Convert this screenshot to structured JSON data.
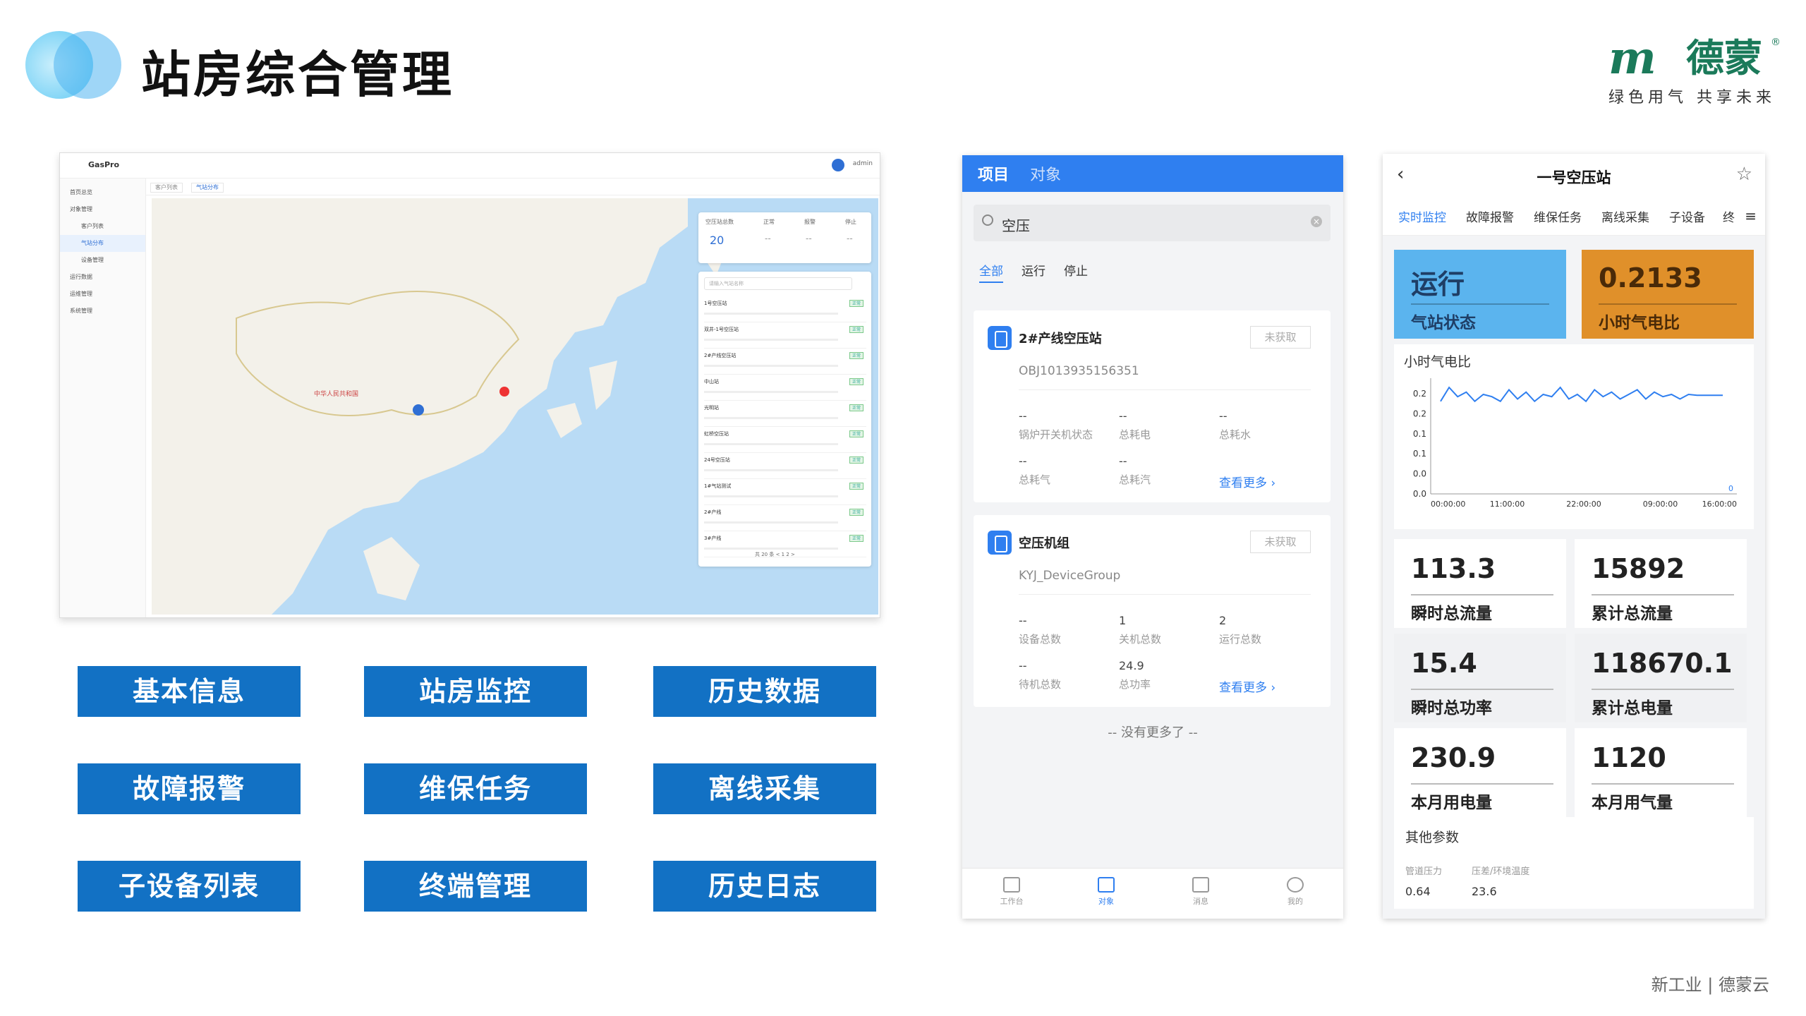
{
  "header": {
    "title": "站房综合管理"
  },
  "logo": {
    "mark": "m",
    "name": "德蒙",
    "registered": "®",
    "slogan": "绿色用气 共享未来"
  },
  "desktop": {
    "app_name": "GasPro",
    "user": "admin",
    "sidebar": [
      "首页总览",
      "对象管理",
      "客户列表",
      "气站分布",
      "设备管理",
      "运行数据",
      "运维管理",
      "系统管理"
    ],
    "tabs": [
      "客户列表",
      "气站分布"
    ],
    "map_label": "中华人民共和国",
    "stats": {
      "headers": [
        "空压站总数",
        "正常",
        "报警",
        "停止"
      ],
      "total": "20",
      "normal": "--",
      "alarm": "--",
      "stop": "--"
    },
    "search_placeholder": "请输入气站名称",
    "stations": [
      "1号空压站",
      "双井-1号空压站",
      "2#产线空压站",
      "中山站",
      "光明站",
      "虹桥空压站",
      "24号空压站",
      "1#气站测试",
      "2#产线",
      "3#产线"
    ],
    "badge": "正常",
    "pager": "共 20 条 < 1 2 >"
  },
  "buttons": [
    "基本信息",
    "站房监控",
    "历史数据",
    "故障报警",
    "维保任务",
    "离线采集",
    "子设备列表",
    "终端管理",
    "历史日志"
  ],
  "phone1": {
    "tabs": [
      "项目",
      "对象"
    ],
    "search": "空压",
    "filters": [
      "全部",
      "运行",
      "停止"
    ],
    "card1": {
      "name": "2#产线空压站",
      "status": "未获取",
      "code": "OBJ1013935156351",
      "fields": [
        {
          "value": "--",
          "label": "锅炉开关机状态"
        },
        {
          "value": "--",
          "label": "总耗电"
        },
        {
          "value": "--",
          "label": "总耗水"
        },
        {
          "value": "--",
          "label": "总耗气"
        },
        {
          "value": "--",
          "label": "总耗汽"
        }
      ],
      "more": "查看更多 ›"
    },
    "card2": {
      "name": "空压机组",
      "status": "未获取",
      "code": "KYJ_DeviceGroup",
      "fields": [
        {
          "value": "--",
          "label": "设备总数"
        },
        {
          "value": "1",
          "label": "关机总数"
        },
        {
          "value": "2",
          "label": "运行总数"
        },
        {
          "value": "--",
          "label": "待机总数"
        },
        {
          "value": "24.9",
          "label": "总功率"
        }
      ],
      "more": "查看更多 ›"
    },
    "end_text": "-- 没有更多了 --",
    "nav": [
      "工作台",
      "对象",
      "消息",
      "我的"
    ]
  },
  "phone2": {
    "title": "一号空压站",
    "back": "‹",
    "star": "☆",
    "tabs": [
      "实时监控",
      "故障报警",
      "维保任务",
      "离线采集",
      "子设备",
      "终"
    ],
    "tile1": {
      "value": "运行",
      "label": "气站状态",
      "color": "#5bb4ee"
    },
    "tile2": {
      "value": "0.2133",
      "label": "小时气电比",
      "color": "#e0902a"
    },
    "chart_title": "小时气电比",
    "stats": [
      {
        "value": "113.3",
        "label": "瞬时总流量"
      },
      {
        "value": "15892",
        "label": "累计总流量"
      },
      {
        "value": "15.4",
        "label": "瞬时总功率"
      },
      {
        "value": "118670.1",
        "label": "累计总电量"
      },
      {
        "value": "230.9",
        "label": "本月用电量"
      },
      {
        "value": "1120",
        "label": "本月用气量"
      }
    ],
    "other": {
      "title": "其他参数",
      "keys": [
        "管道压力",
        "压差/环境温度"
      ],
      "values": [
        "0.64",
        "23.6"
      ]
    }
  },
  "chart_data": {
    "type": "line",
    "title": "小时气电比",
    "x_ticks": [
      "00:00:00",
      "11:00:00",
      "22:00:00",
      "09:00:00",
      "16:00:00"
    ],
    "y_ticks": [
      "0.2",
      "0.2",
      "0.1",
      "0.1",
      "0.0",
      "0.0"
    ],
    "ylim": [
      0,
      0.25
    ],
    "end_marker": "0",
    "values": [
      0.2,
      0.23,
      0.21,
      0.22,
      0.2,
      0.215,
      0.21,
      0.2,
      0.225,
      0.205,
      0.22,
      0.2,
      0.215,
      0.21,
      0.23,
      0.205,
      0.215,
      0.2,
      0.225,
      0.21,
      0.22,
      0.205,
      0.215,
      0.225,
      0.205,
      0.22,
      0.21,
      0.215,
      0.205,
      0.215,
      0.213,
      0.213,
      0.213,
      0.213
    ]
  },
  "footer": "新工业 | 德蒙云"
}
